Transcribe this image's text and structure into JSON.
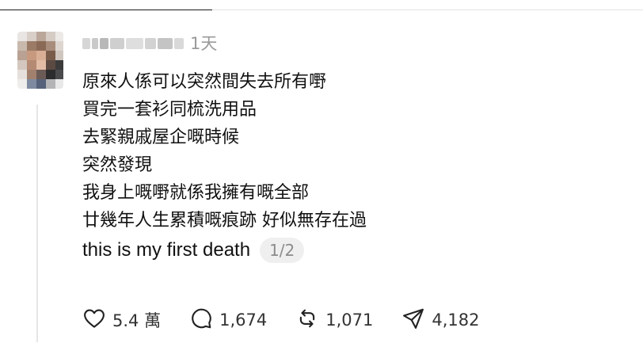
{
  "header": {
    "time_ago": "1天"
  },
  "post": {
    "lines": [
      "原來人係可以突然間失去所有嘢",
      "買完一套衫同梳洗用品",
      "去緊親戚屋企嘅時候",
      "突然發現",
      "我身上嘅嘢就係我擁有嘅全部",
      "廿幾年人生累積嘅痕跡 好似無存在過",
      "this is my first death"
    ],
    "page_indicator": "1/2"
  },
  "actions": {
    "likes": "5.4 萬",
    "comments": "1,674",
    "reposts": "1,071",
    "shares": "4,182"
  },
  "icons": [
    "heart-icon",
    "comment-icon",
    "repost-icon",
    "share-icon"
  ],
  "colors": {
    "muted": "#9a9a9a",
    "pill_bg": "#efefef",
    "thread_line": "#e6e6e6"
  }
}
